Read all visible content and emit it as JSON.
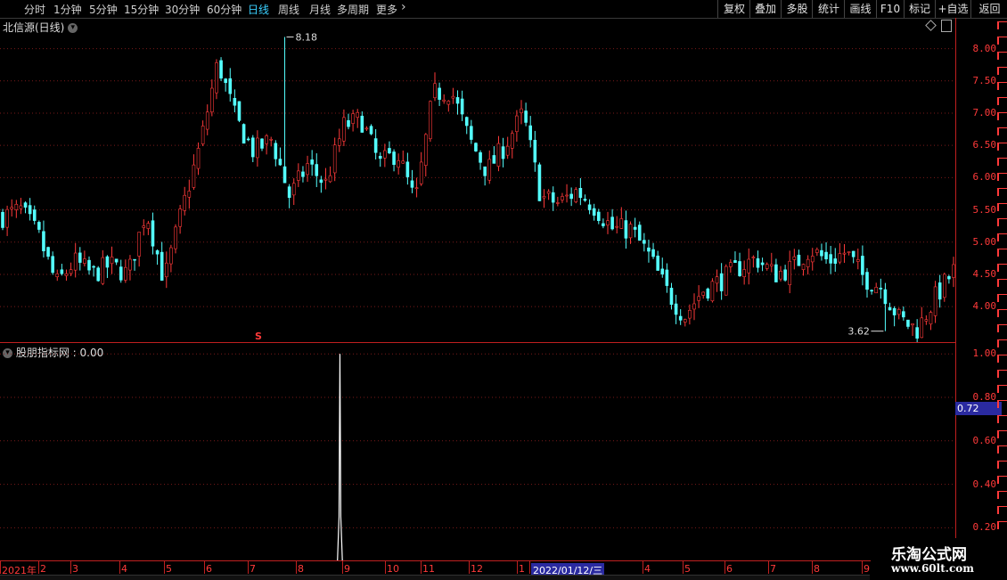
{
  "toolbar": {
    "periods": [
      {
        "label": "分时"
      },
      {
        "label": "1分钟"
      },
      {
        "label": "5分钟"
      },
      {
        "label": "15分钟"
      },
      {
        "label": "30分钟"
      },
      {
        "label": "60分钟"
      },
      {
        "label": "日线",
        "active": true
      },
      {
        "label": "周线"
      },
      {
        "label": "月线"
      },
      {
        "label": "多周期"
      },
      {
        "label": "更多"
      }
    ],
    "right_buttons": [
      {
        "label": "复权"
      },
      {
        "label": "叠加"
      },
      {
        "label": "多股"
      },
      {
        "label": "统计"
      },
      {
        "label": "画线"
      },
      {
        "label": "F10"
      },
      {
        "label": "标记"
      },
      {
        "label": "+自选"
      },
      {
        "label": "返回"
      }
    ]
  },
  "main_panel": {
    "title": "北信源(日线)",
    "high_label": "8.18",
    "low_label": "3.62",
    "marker": "S",
    "y_ticks": [
      "8.00",
      "7.50",
      "7.00",
      "6.50",
      "6.00",
      "5.50",
      "5.00",
      "4.50",
      "4.00"
    ]
  },
  "indicator_panel": {
    "title": "股朋指标网 : 0.00",
    "y_ticks": [
      "1.00",
      "0.80",
      "0.60",
      "0.40",
      "0.20"
    ],
    "current_value": "0.72"
  },
  "x_axis": {
    "labels": [
      "2021年",
      "2",
      "3",
      "4",
      "5",
      "6",
      "7",
      "8",
      "9",
      "10",
      "11",
      "12",
      "1",
      "2022/01/12/三",
      "4",
      "5",
      "6",
      "7",
      "8",
      "9"
    ]
  },
  "watermark": {
    "line1": "乐淘公式网",
    "line2": "www.60lt.com"
  },
  "colors": {
    "up": "#ff3a3a",
    "down": "#54ffff",
    "axis": "#c02020",
    "grid": "#7a1a1a",
    "highlight": "#2a2aa0"
  },
  "chart_data": {
    "type": "candlestick",
    "title": "北信源(日线)",
    "ylim": [
      3.45,
      8.45
    ],
    "x_start": "2021",
    "high": 8.18,
    "low": 3.62,
    "anchors": [
      5.4,
      5.5,
      5.1,
      4.35,
      4.7,
      4.5,
      4.65,
      4.5,
      5.5,
      4.4,
      5.5,
      6.5,
      7.8,
      6.9,
      6.4,
      6.6,
      5.7,
      6.2,
      5.9,
      6.8,
      6.9,
      6.2,
      6.4,
      5.6,
      7.3,
      7.35,
      6.6,
      6.1,
      6.5,
      7.0,
      5.7,
      5.6,
      5.8,
      5.55,
      5.2,
      5.2,
      4.8,
      4.25,
      3.85,
      4.25,
      4.4,
      4.6,
      4.75,
      4.5,
      4.6,
      4.9,
      4.7,
      4.85,
      4.45,
      4.3,
      3.8,
      3.65,
      4.15,
      4.55
    ],
    "indicator": {
      "name": "股朋指标网",
      "value": 0.0,
      "ylim": [
        0.05,
        1.05
      ],
      "spike_x_fraction": 0.395,
      "spike_value": 1.0
    }
  }
}
